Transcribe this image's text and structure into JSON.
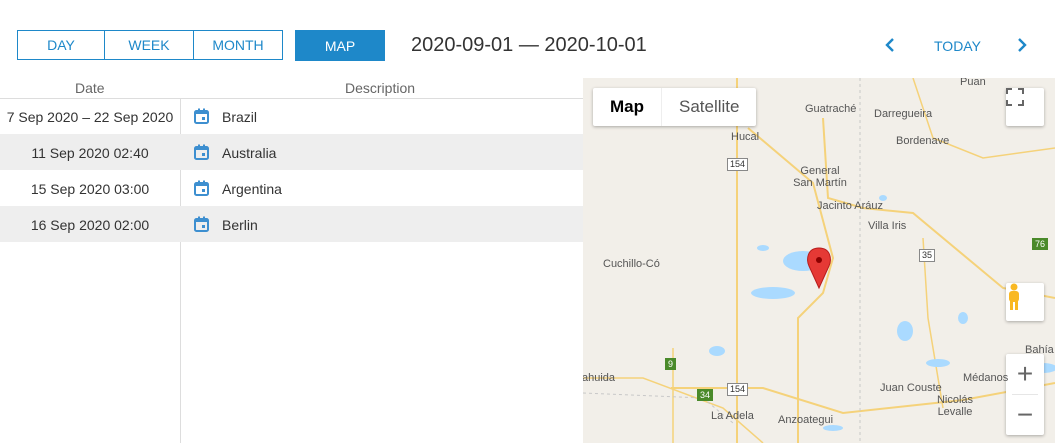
{
  "toolbar": {
    "views": [
      "DAY",
      "WEEK",
      "MONTH"
    ],
    "map_label": "MAP",
    "date_range": "2020-09-01 — 2020-10-01",
    "today_label": "TODAY",
    "prev_icon": "chevron-left-icon",
    "next_icon": "chevron-right-icon"
  },
  "list": {
    "headers": {
      "date": "Date",
      "description": "Description"
    },
    "rows": [
      {
        "date": "7 Sep 2020 – 22 Sep 2020",
        "description": "Brazil"
      },
      {
        "date": "11 Sep 2020 02:40",
        "description": "Australia"
      },
      {
        "date": "15 Sep 2020 03:00",
        "description": "Argentina"
      },
      {
        "date": "16 Sep 2020 02:00",
        "description": "Berlin"
      }
    ],
    "event_icon": "calendar-icon"
  },
  "map": {
    "type_active": "Map",
    "type_other": "Satellite",
    "places": {
      "puan": "Puan",
      "guatrache": "Guatraché",
      "darregueira": "Darregueira",
      "hucal": "Hucal",
      "bordenave": "Bordenave",
      "general_san_martin": "General San Martín",
      "jacinto_arauz": "Jacinto Aráuz",
      "villa_iris": "Villa Iris",
      "cuchillo_co": "Cuchillo-Có",
      "bahia": "Bahía",
      "ahuida": "ahuida",
      "juan_couste": "Juan Couste",
      "medanos": "Médanos",
      "nicolas_levalle": "Nicolás Levalle",
      "la_adela": "La Adela",
      "anzoategui": "Anzoategui"
    },
    "routes": {
      "r154a": "154",
      "r35": "35",
      "r76": "76",
      "r9": "9",
      "r154b": "154",
      "r34": "34"
    },
    "colors": {
      "accent": "#1e88c9",
      "pin": "#e53935",
      "water": "#aadaff",
      "road": "#f5d27a"
    }
  }
}
